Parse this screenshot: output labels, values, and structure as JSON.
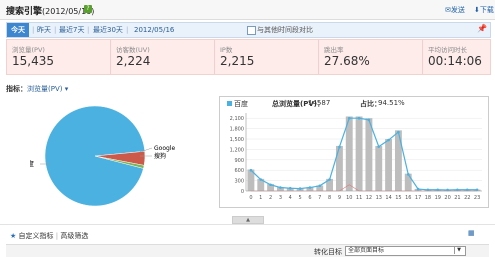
{
  "header": {
    "title": "搜索引擎",
    "date": "(2012/05/16)",
    "help_glyph": "?",
    "send_label": "发送",
    "download_label": "下载"
  },
  "toolbar": {
    "tabs": [
      "今天",
      "昨天",
      "最近7天",
      "最近30天",
      "2012/05/16"
    ],
    "compare_label": "与其他时间段对比"
  },
  "metrics": [
    {
      "label": "浏览量(PV)",
      "value": "15,435"
    },
    {
      "label": "访客数(UV)",
      "value": "2,224"
    },
    {
      "label": "IP数",
      "value": "2,215"
    },
    {
      "label": "跳出率",
      "value": "27.68%"
    },
    {
      "label": "平均访问时长",
      "value": "00:14:06"
    }
  ],
  "indicator": {
    "label": "指标：",
    "value": "浏览量(PV) ▾"
  },
  "pie": {
    "label_main": "百度",
    "label_google": "Google",
    "label_sogou": "搜狗",
    "share_baidu": 0.945,
    "share_google": 0.045,
    "share_sogou": 0.01,
    "colors": {
      "baidu": "#4ab1e0",
      "google": "#cc5a4a",
      "sogou": "#7cb45a"
    }
  },
  "chart_legend": {
    "name": "百度",
    "total_label": "总浏览量(PV)：",
    "total_value": "14587",
    "share_label": "占比：",
    "share_value": "94.51%"
  },
  "chart_data": {
    "type": "bar",
    "categories": [
      "0",
      "1",
      "2",
      "3",
      "4",
      "5",
      "6",
      "7",
      "8",
      "9",
      "10",
      "11",
      "12",
      "13",
      "14",
      "15",
      "16",
      "17",
      "18",
      "19",
      "20",
      "21",
      "22",
      "23"
    ],
    "series": [
      {
        "values": [
          620,
          350,
          200,
          110,
          90,
          80,
          110,
          160,
          350,
          1300,
          2150,
          2150,
          2100,
          1300,
          1500,
          1750,
          500,
          60,
          40,
          40,
          35,
          40,
          40,
          40
        ]
      },
      {
        "values": [
          600,
          330,
          180,
          100,
          80,
          70,
          100,
          150,
          330,
          1270,
          2100,
          2100,
          2050,
          1280,
          1470,
          1700,
          480,
          55,
          35,
          35,
          30,
          35,
          35,
          35
        ]
      },
      {
        "values": [
          0,
          0,
          0,
          0,
          0,
          0,
          0,
          0,
          0,
          0,
          180,
          0,
          0,
          0,
          0,
          0,
          0,
          0,
          0,
          0,
          0,
          0,
          0,
          0
        ]
      }
    ],
    "ylim": [
      0,
      2250
    ],
    "yticks": [
      "0",
      "150",
      "300",
      "450",
      "600",
      "750",
      "900",
      "1,050",
      "1,200",
      "1,350",
      "1,500",
      "1,650",
      "1,800",
      "1,950",
      "2,100",
      "2,250"
    ],
    "grid": true
  },
  "footer": {
    "custom_indicator": "自定义指标",
    "advanced_filter": "高级筛选",
    "conversion_label": "转化目标",
    "conversion_value": "全部页面目标"
  }
}
